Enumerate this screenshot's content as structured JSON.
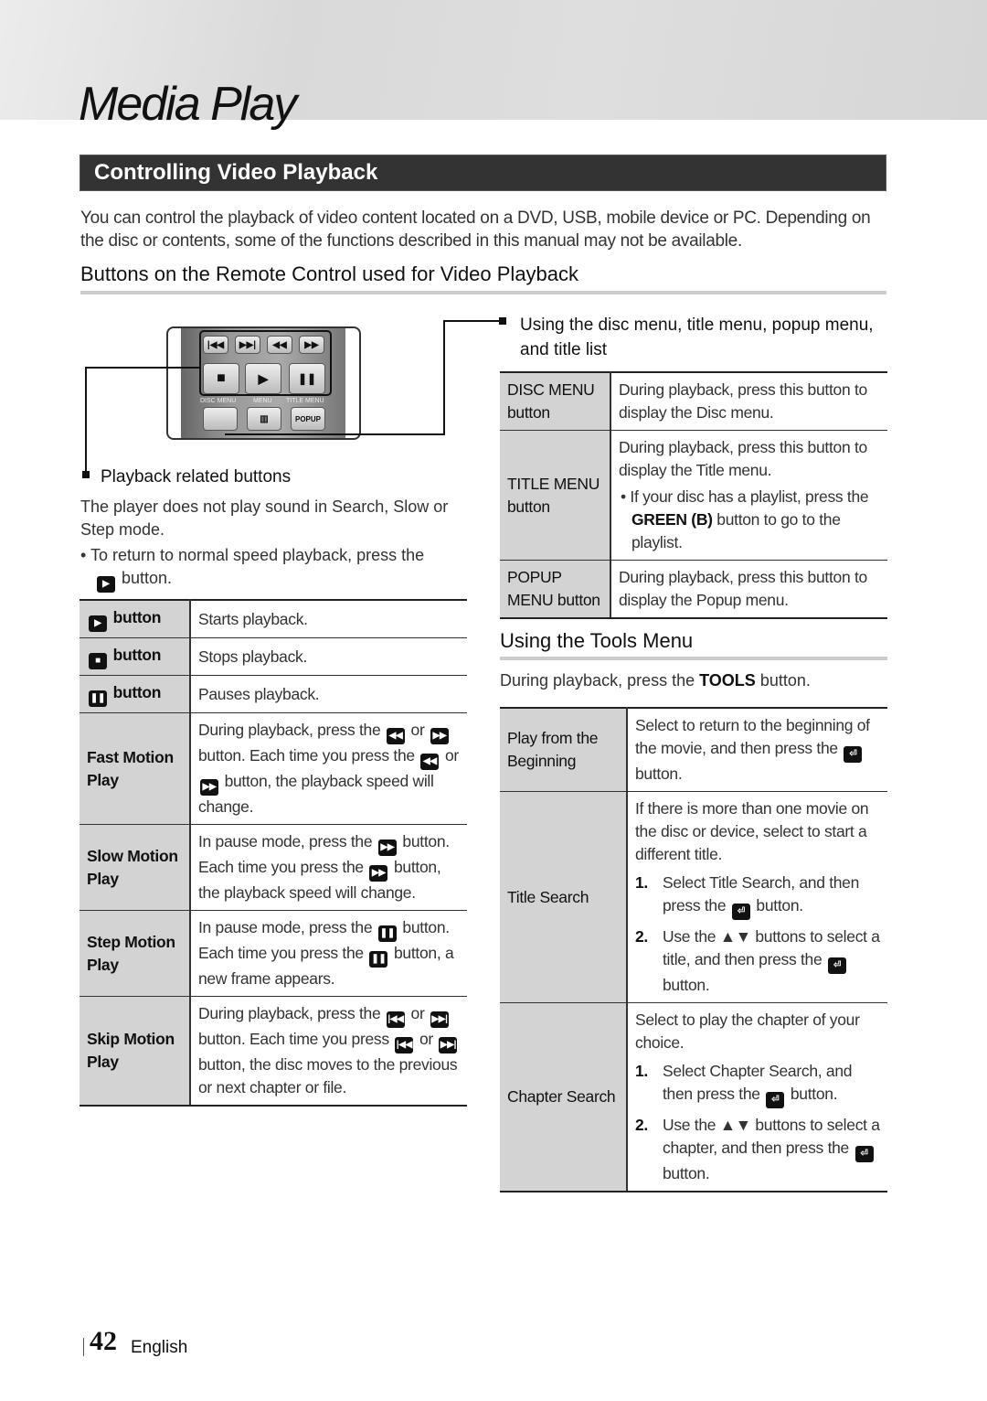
{
  "chapter_title": "Media Play",
  "section_title": "Controlling Video Playback",
  "intro": "You can control the playback of video content located on a DVD, USB, mobile device or PC. Depending on the disc or contents, some of the functions described in this manual may not be available.",
  "subheading_buttons": "Buttons on the Remote Control used for Video Playback",
  "remote": {
    "labels": [
      "DISC MENU",
      "MENU",
      "TITLE MENU"
    ],
    "popup_label": "POPUP",
    "icons": [
      "skip-back",
      "skip-forward",
      "rewind",
      "fast-forward",
      "stop",
      "play",
      "pause"
    ]
  },
  "playback_callout": "Playback related buttons",
  "playback_note": "The player does not play sound in Search, Slow or Step mode.",
  "playback_bullet_pre": "To return to normal speed playback, press the",
  "playback_bullet_post": "button.",
  "playback_table": [
    {
      "icon": "▶",
      "key": "button",
      "value": "Starts playback."
    },
    {
      "icon": "■",
      "key": "button",
      "value": "Stops playback."
    },
    {
      "icon": "❚❚",
      "key": "button",
      "value": "Pauses playback."
    },
    {
      "key": "Fast Motion Play",
      "value_parts": [
        "During playback, press the",
        "◀◀",
        "or",
        "▶▶",
        "button.",
        "Each time you press the",
        "◀◀",
        "or",
        "▶▶",
        "button, the playback speed will change."
      ]
    },
    {
      "key": "Slow Motion Play",
      "value_parts": [
        "In pause mode, press the",
        "▶▶",
        "button.",
        "Each time you press the",
        "▶▶",
        "button, the playback speed will change."
      ]
    },
    {
      "key": "Step Motion Play",
      "value_parts": [
        "In pause mode, press the",
        "❚❚",
        "button.",
        "Each time you press the",
        "❚❚",
        "button, a new frame appears."
      ]
    },
    {
      "key": "Skip Motion Play",
      "value_parts": [
        "During playback, press the",
        "|◀◀",
        "or",
        "▶▶|",
        "button.",
        "Each time you press",
        "|◀◀",
        "or",
        "▶▶|",
        "button, the disc moves to the previous or next chapter or file."
      ]
    }
  ],
  "menu_callout": "Using the disc menu, title menu, popup menu, and title list",
  "menu_table": [
    {
      "key": "DISC MENU button",
      "value": "During playback, press this button to display the Disc menu."
    },
    {
      "key": "TITLE MENU button",
      "value": "During playback, press this button to display the Title menu.",
      "bullet_bold": "GREEN (B)",
      "bullet_pre": "If your disc has a playlist, press the",
      "bullet_post": "button to go to the playlist."
    },
    {
      "key": "POPUP MENU button",
      "value": "During playback, press this button to display the Popup menu."
    }
  ],
  "subheading_tools": "Using the Tools Menu",
  "tools_intro_pre": "During playback, press the",
  "tools_intro_bold": "TOOLS",
  "tools_intro_post": "button.",
  "tools_table": [
    {
      "key": "Play from the Beginning",
      "value_pre": "Select to return to the beginning of the movie, and then press the",
      "value_post": "button."
    },
    {
      "key": "Title Search",
      "value": "If there is more than one movie on the disc or device, select to start a different title.",
      "steps": [
        {
          "num": "1.",
          "pre": "Select Title Search, and then press the",
          "post": "button."
        },
        {
          "num": "2.",
          "pre": "Use the ▲▼ buttons to select a title, and then press the",
          "post": "button."
        }
      ]
    },
    {
      "key": "Chapter Search",
      "value": "Select to play the chapter of your choice.",
      "steps": [
        {
          "num": "1.",
          "pre": "Select Chapter Search, and then press the",
          "post": "button."
        },
        {
          "num": "2.",
          "pre": "Use the ▲▼ buttons to select a chapter, and then press the",
          "post": "button."
        }
      ]
    }
  ],
  "enter_icon": "⏎",
  "footer": {
    "page_number": "42",
    "language": "English"
  }
}
